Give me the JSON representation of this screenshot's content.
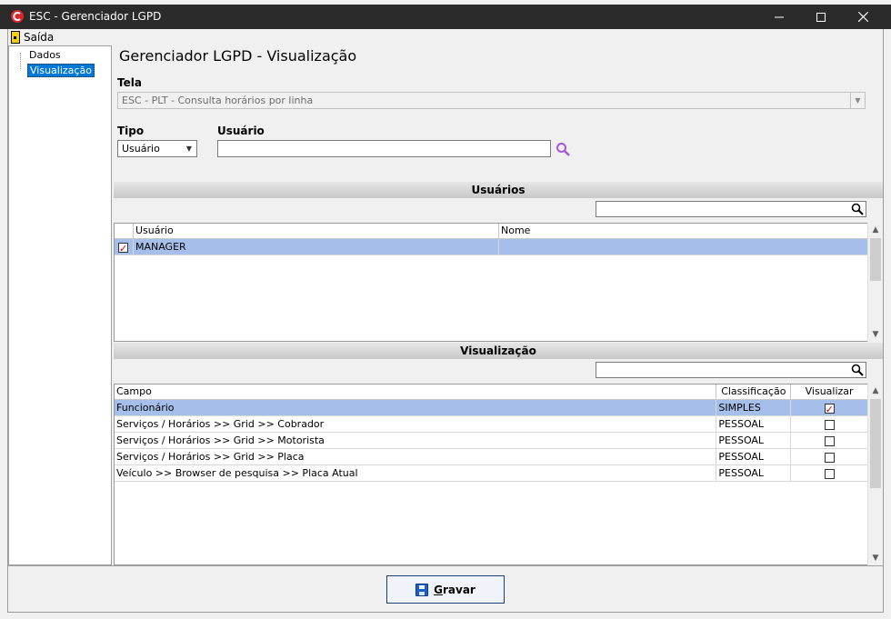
{
  "window": {
    "title": "ESC - Gerenciador LGPD",
    "controls": {
      "minimize": "—",
      "maximize": "☐",
      "close": "✕"
    }
  },
  "menu": {
    "saida": "Saída"
  },
  "tree": {
    "items": [
      "Dados",
      "Visualização"
    ],
    "selected": "Visualização"
  },
  "page": {
    "heading": "Gerenciador LGPD - Visualização"
  },
  "tela": {
    "label": "Tela",
    "value": "ESC - PLT - Consulta horários por linha"
  },
  "tipo": {
    "label": "Tipo",
    "value": "Usuário"
  },
  "usuario": {
    "label": "Usuário",
    "value": ""
  },
  "usuarios_section": {
    "title": "Usuários",
    "columns": [
      "",
      "Usuário",
      "Nome"
    ],
    "rows": [
      {
        "checked": true,
        "usuario": "MANAGER",
        "nome": ""
      }
    ]
  },
  "visualizacao_section": {
    "title": "Visualização",
    "columns": [
      "Campo",
      "Classificação",
      "Visualizar"
    ],
    "rows": [
      {
        "campo": "Funcionário",
        "classificacao": "SIMPLES",
        "visualizar": true
      },
      {
        "campo": "Serviços / Horários >> Grid >> Cobrador",
        "classificacao": "PESSOAL",
        "visualizar": false
      },
      {
        "campo": "Serviços / Horários >> Grid >> Motorista",
        "classificacao": "PESSOAL",
        "visualizar": false
      },
      {
        "campo": "Serviços / Horários >> Grid >> Placa",
        "classificacao": "PESSOAL",
        "visualizar": false
      },
      {
        "campo": "Veículo >> Browser de pesquisa >> Placa Atual",
        "classificacao": "PESSOAL",
        "visualizar": false
      }
    ]
  },
  "buttons": {
    "gravar_first": "G",
    "gravar_rest": "ravar"
  },
  "colors": {
    "selection": "#a6bfea",
    "titlebar": "#2b2b2b",
    "accent_red": "#d00000"
  }
}
